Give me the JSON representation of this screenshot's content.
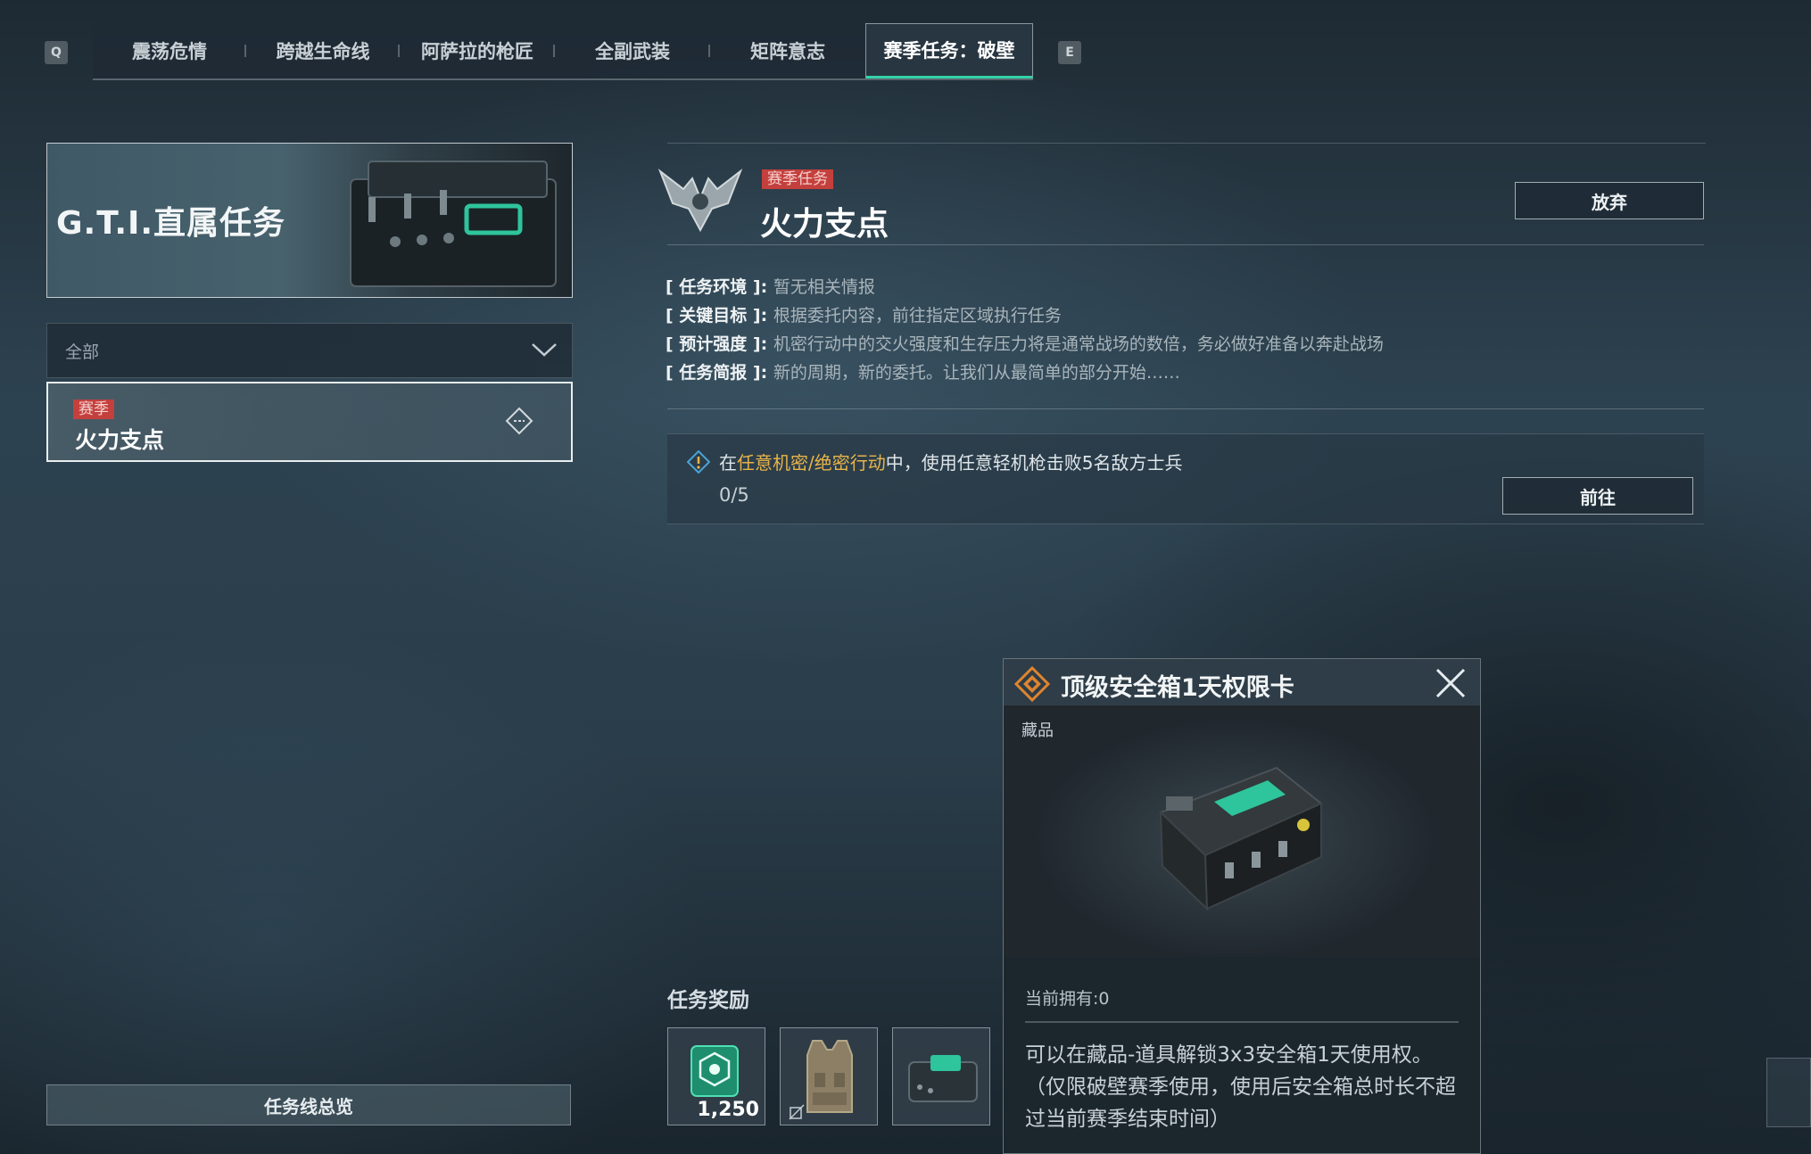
{
  "tabs": {
    "prev_key": "Q",
    "next_key": "E",
    "items": [
      {
        "label": "震荡危情"
      },
      {
        "label": "跨越生命线"
      },
      {
        "label": "阿萨拉的枪匠"
      },
      {
        "label": "全副武装"
      },
      {
        "label": "矩阵意志"
      },
      {
        "label": "赛季任务：破壁",
        "active": true
      }
    ]
  },
  "sidebar": {
    "banner_title": "G.T.I.直属任务",
    "filter_value": "全部",
    "mission_item": {
      "tag": "赛季",
      "title": "火力支点"
    },
    "overview_button": "任务线总览"
  },
  "detail": {
    "tag": "赛季任务",
    "title": "火力支点",
    "abandon_button": "放弃",
    "info": [
      {
        "label": "[ 任务环境 ]",
        "value": "暂无相关情报"
      },
      {
        "label": "[ 关键目标 ]",
        "value": "根据委托内容，前往指定区域执行任务"
      },
      {
        "label": "[ 预计强度 ]",
        "value": "机密行动中的交火强度和生存压力将是通常战场的数倍，务必做好准备以奔赴战场"
      },
      {
        "label": "[ 任务简报 ]",
        "value": "新的周期，新的委托。让我们从最简单的部分开始……"
      }
    ],
    "objective": {
      "prefix": "在",
      "highlight": "任意机密/绝密行动",
      "suffix": "中，使用任意轻机枪击败5名敌方士兵",
      "progress": "0/5",
      "go_button": "前往"
    },
    "rewards_label": "任务奖励",
    "rewards": [
      {
        "icon": "currency-badge-icon",
        "count": "1,250"
      },
      {
        "icon": "tactical-vest-icon"
      },
      {
        "icon": "safe-box-icon"
      }
    ]
  },
  "popup": {
    "title": "顶级安全箱1天权限卡",
    "category": "藏品",
    "owned": "当前拥有:0",
    "description": "可以在藏品-道具解锁3x3安全箱1天使用权。（仅限破壁赛季使用，使用后安全箱总时长不超过当前赛季结束时间）"
  },
  "colors": {
    "accent_green": "#34d3a6",
    "tag_red": "#c4403d",
    "highlight_gold": "#e8b44a",
    "rarity_orange": "#e0842f"
  }
}
